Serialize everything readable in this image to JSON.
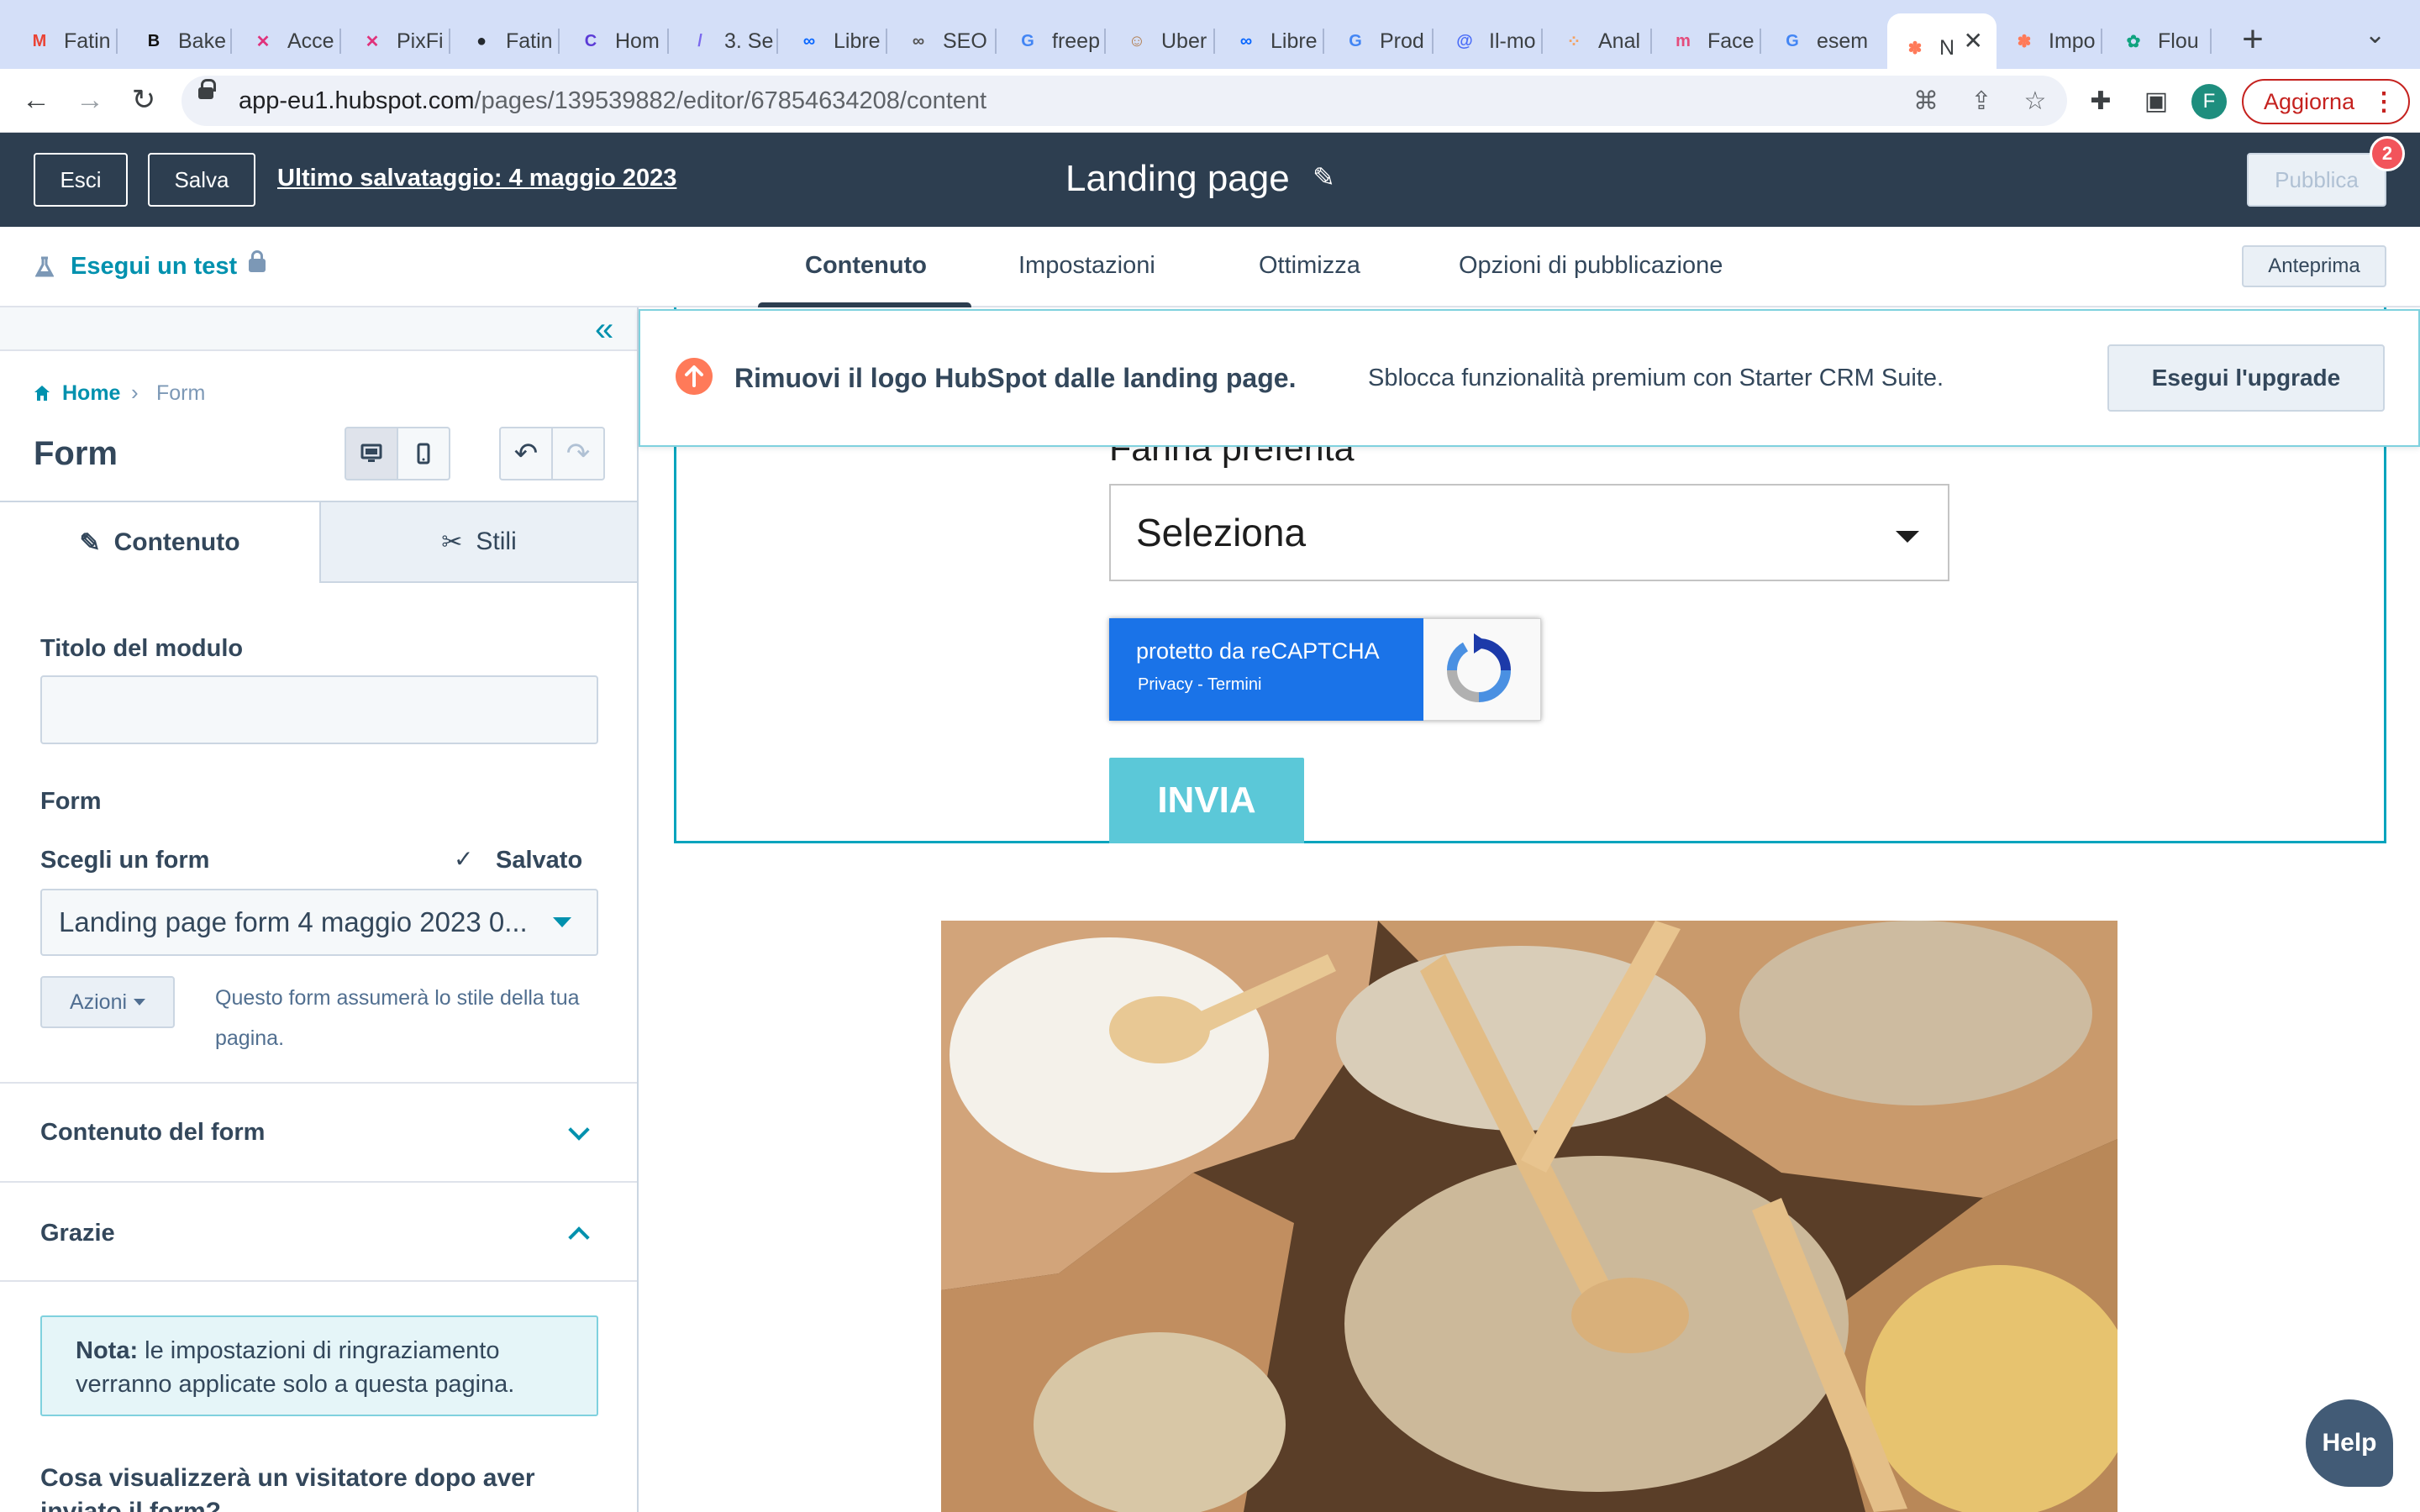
{
  "browser": {
    "tabs": [
      {
        "title": "Fatin",
        "favicon": "gmail-icon",
        "color": "#ea4335",
        "glyph": "M"
      },
      {
        "title": "Bake",
        "favicon": "b-logo-icon",
        "color": "#111111",
        "glyph": "B"
      },
      {
        "title": "Acce",
        "favicon": "mailerlite-icon",
        "color": "#e0327b",
        "glyph": "✕"
      },
      {
        "title": "PixFi",
        "favicon": "mailerlite-icon",
        "color": "#e0327b",
        "glyph": "✕"
      },
      {
        "title": "Fatin",
        "favicon": "github-icon",
        "color": "#24292f",
        "glyph": "●"
      },
      {
        "title": "Hom",
        "favicon": "canva-icon",
        "color": "#5b3bd6",
        "glyph": "C"
      },
      {
        "title": "3. Se",
        "favicon": "clickup-icon",
        "color": "#7b68ee",
        "glyph": "/"
      },
      {
        "title": "Libre",
        "favicon": "meta-icon",
        "color": "#0866ff",
        "glyph": "∞"
      },
      {
        "title": "SEO",
        "favicon": "seo-icon",
        "color": "#555555",
        "glyph": "∞"
      },
      {
        "title": "freep",
        "favicon": "google-icon",
        "color": "#4285f4",
        "glyph": "G"
      },
      {
        "title": "Uber",
        "favicon": "uber-avatar-icon",
        "color": "#b07a4a",
        "glyph": "☺"
      },
      {
        "title": "Libre",
        "favicon": "meta-icon",
        "color": "#0866ff",
        "glyph": "∞"
      },
      {
        "title": "Prod",
        "favicon": "google-icon",
        "color": "#4285f4",
        "glyph": "G"
      },
      {
        "title": "Il-mo",
        "favicon": "spiral-icon",
        "color": "#4a6cf7",
        "glyph": "@"
      },
      {
        "title": "Anal",
        "favicon": "analytics-icon",
        "color": "#f4a261",
        "glyph": "⁘"
      },
      {
        "title": "Face",
        "favicon": "monday-icon",
        "color": "#e44c7c",
        "glyph": "m"
      },
      {
        "title": "esem",
        "favicon": "google-icon",
        "color": "#4285f4",
        "glyph": "G"
      },
      {
        "title": "N",
        "favicon": "hubspot-icon",
        "color": "#ff7a59",
        "glyph": "✽"
      },
      {
        "title": "Impo",
        "favicon": "hubspot-icon",
        "color": "#ff7a59",
        "glyph": "✽"
      },
      {
        "title": "Flou",
        "favicon": "chatgpt-icon",
        "color": "#10a37f",
        "glyph": "✿"
      }
    ],
    "url_host": "app-eu1.hubspot.com",
    "url_path": "/pages/139539882/editor/67854634208/content",
    "profile_initial": "F",
    "update_label": "Aggiorna"
  },
  "header": {
    "exit_label": "Esci",
    "save_label": "Salva",
    "last_saved": "Ultimo salvataggio: 4 maggio 2023",
    "page_name": "Landing page",
    "publish_label": "Pubblica",
    "publish_badge": "2"
  },
  "tabbar": {
    "test_label": "Esegui un test",
    "tabs": [
      "Contenuto",
      "Impostazioni",
      "Ottimizza",
      "Opzioni di pubblicazione"
    ],
    "preview_label": "Anteprima"
  },
  "sidebar": {
    "breadcrumb_home": "Home",
    "breadcrumb_current": "Form",
    "module_title": "Form",
    "tab_content": "Contenuto",
    "tab_styles": "Stili",
    "module_title_label": "Titolo del modulo",
    "module_title_value": "",
    "form_section_label": "Form",
    "choose_form_label": "Scegli un form",
    "saved_label": "Salvato",
    "form_select_value": "Landing page form 4 maggio 2023 0...",
    "actions_label": "Azioni",
    "form_style_note": "Questo form assumerà lo stile della tua pagina.",
    "form_content_label": "Contenuto del form",
    "thanks_label": "Grazie",
    "note_bold": "Nota:",
    "note_text": " le impostazioni di ringraziamento verranno applicate solo a questa pagina.",
    "after_submit_label": "Cosa visualizzerà un visitatore dopo aver inviato il form?"
  },
  "canvas": {
    "field_label": "Farina preferita",
    "select_value": "Seleziona",
    "recaptcha_text": "protetto da reCAPTCHA",
    "recaptcha_links": "Privacy - Termini",
    "submit_label": "INVIA"
  },
  "banner": {
    "title": "Rimuovi il logo HubSpot dalle landing page.",
    "text": "Sblocca funzionalità premium con Starter CRM Suite.",
    "button": "Esegui l'upgrade"
  },
  "help_label": "Help",
  "colors": {
    "header_bg": "#2d3e50",
    "accent_teal": "#0091ae",
    "submit_button": "#5bc8d8",
    "upgrade_icon": "#ff7a59"
  }
}
